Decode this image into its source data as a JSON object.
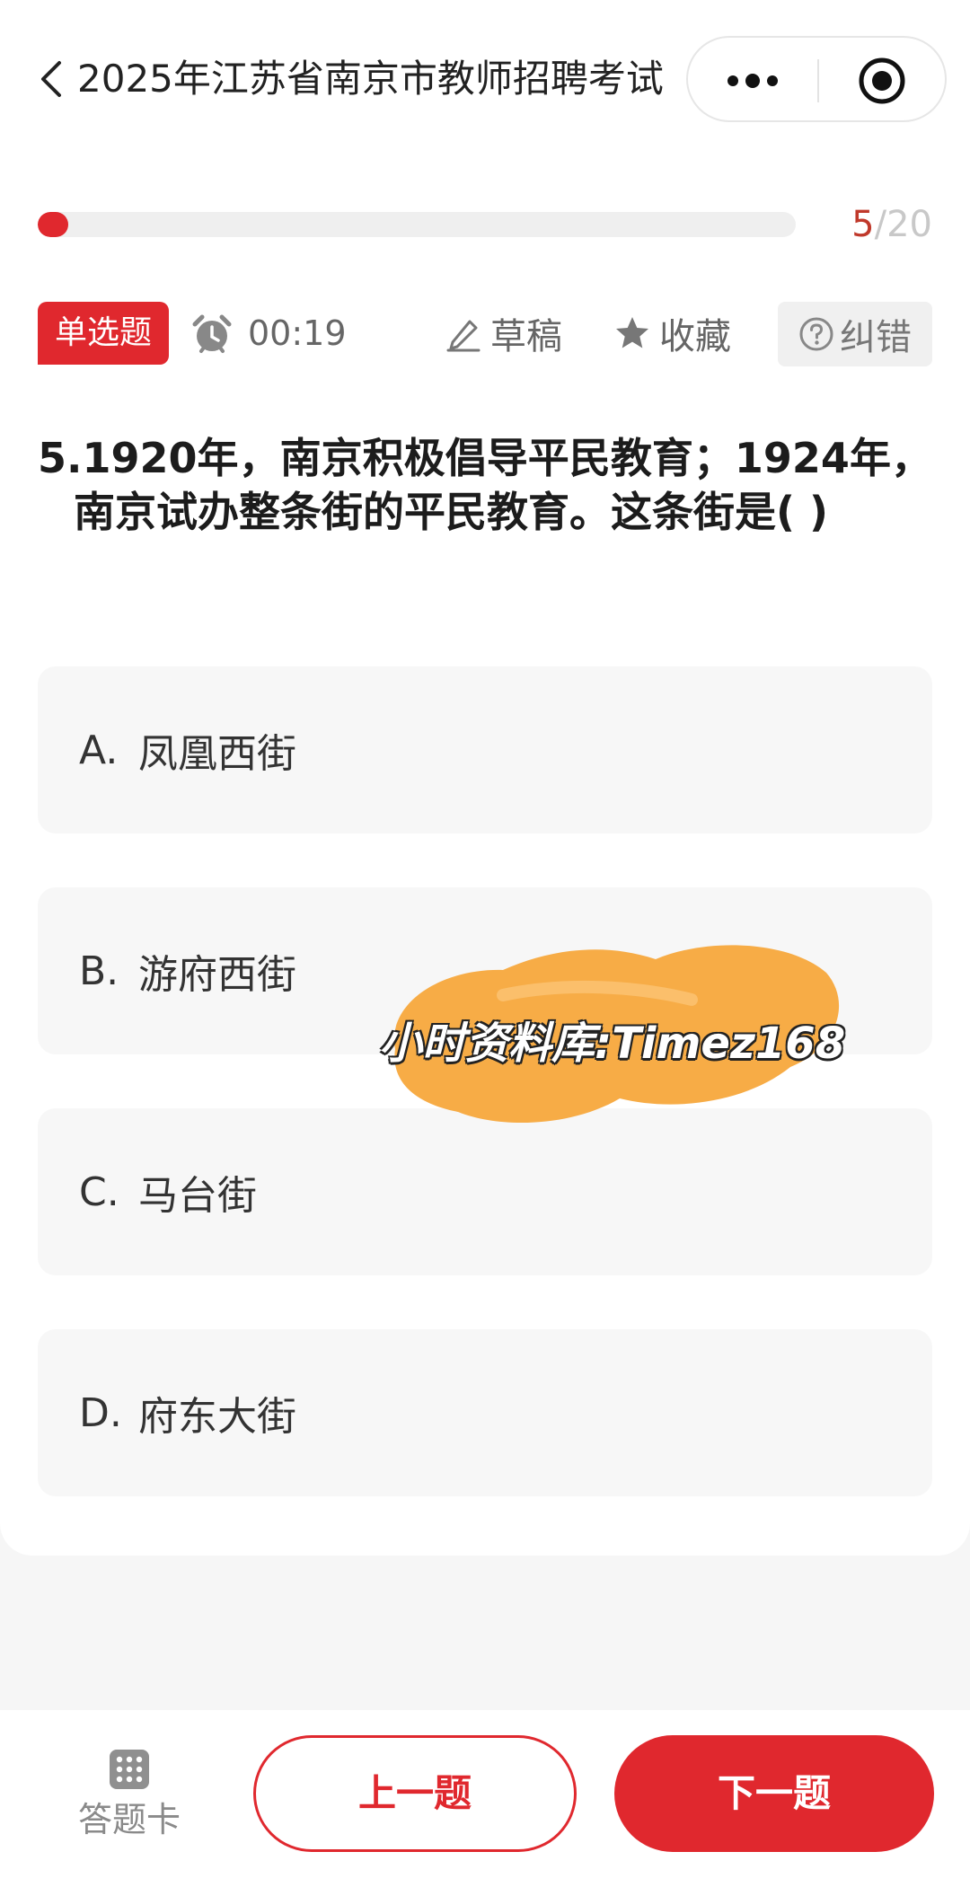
{
  "header": {
    "title": "2025年江苏省南京市教师招聘考试",
    "back_icon": "chevron-left-icon",
    "more_icon": "more-dots-icon",
    "close_icon": "target-close-icon"
  },
  "progress": {
    "current": "5",
    "separator": "/",
    "total": "20",
    "fraction": 0.05
  },
  "meta": {
    "type_badge": "单选题",
    "timer": "00:19",
    "draft_label": "草稿",
    "favorite_label": "收藏",
    "report_label": "纠错"
  },
  "question": {
    "text": "5.1920年，南京积极倡导平民教育；1924年，南京试办整条街的平民教育。这条街是(    )"
  },
  "options": [
    {
      "letter": "A.",
      "text": "凤凰西街"
    },
    {
      "letter": "B.",
      "text": "游府西街"
    },
    {
      "letter": "C.",
      "text": "马台街"
    },
    {
      "letter": "D.",
      "text": "府东大街"
    }
  ],
  "watermark": {
    "text": "小时资料库:Timez168"
  },
  "footer": {
    "answer_card_label": "答题卡",
    "prev_label": "上一题",
    "next_label": "下一题"
  },
  "colors": {
    "accent": "#e0282e",
    "watermark_blob": "#f7a83c"
  }
}
